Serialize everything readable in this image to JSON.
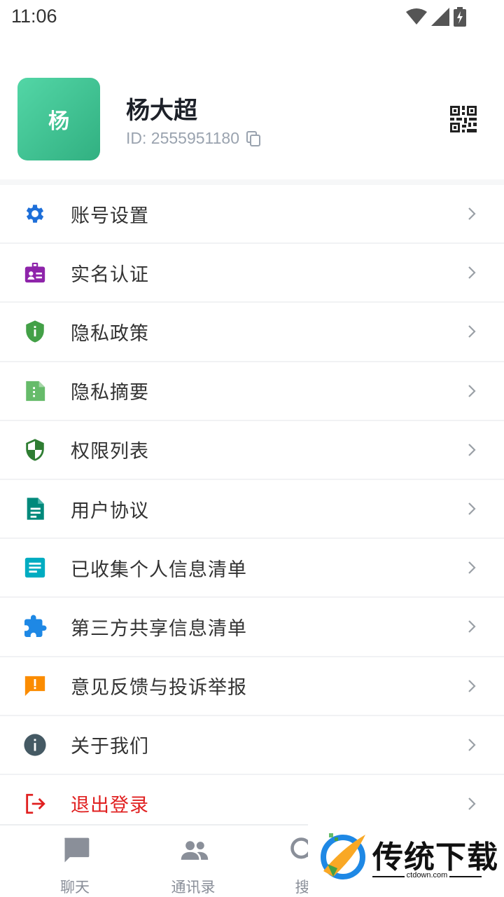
{
  "status_bar": {
    "time": "11:06"
  },
  "profile": {
    "avatar_text": "杨",
    "name": "杨大超",
    "id_text": "ID: 2555951180"
  },
  "menu": {
    "items": [
      {
        "label": "账号设置",
        "icon": "gear-icon",
        "icon_color": "#1e6fd9"
      },
      {
        "label": "实名认证",
        "icon": "id-badge-icon",
        "icon_color": "#8e24aa"
      },
      {
        "label": "隐私政策",
        "icon": "shield-info-icon",
        "icon_color": "#43a047"
      },
      {
        "label": "隐私摘要",
        "icon": "document-icon",
        "icon_color": "#66bb6a"
      },
      {
        "label": "权限列表",
        "icon": "shield-half-icon",
        "icon_color": "#2e7d32"
      },
      {
        "label": "用户协议",
        "icon": "file-text-icon",
        "icon_color": "#00897b"
      },
      {
        "label": "已收集个人信息清单",
        "icon": "list-doc-icon",
        "icon_color": "#00acc1"
      },
      {
        "label": "第三方共享信息清单",
        "icon": "puzzle-icon",
        "icon_color": "#1e88e5"
      },
      {
        "label": "意见反馈与投诉举报",
        "icon": "feedback-icon",
        "icon_color": "#fb8c00"
      },
      {
        "label": "关于我们",
        "icon": "info-icon",
        "icon_color": "#455a64"
      },
      {
        "label": "退出登录",
        "icon": "logout-icon",
        "icon_color": "#e02020"
      }
    ]
  },
  "bottom_nav": {
    "items": [
      {
        "label": "聊天",
        "icon": "chat-icon"
      },
      {
        "label": "通讯录",
        "icon": "contacts-icon"
      },
      {
        "label": "搜",
        "icon": "search-icon"
      }
    ]
  },
  "watermark": {
    "title": "传统下载",
    "subtitle": "ctdown.com"
  },
  "colors": {
    "accent_green": "#3cc28f",
    "text_primary": "#1d2129",
    "text_secondary": "#9aa3af",
    "logout_red": "#e02020"
  }
}
